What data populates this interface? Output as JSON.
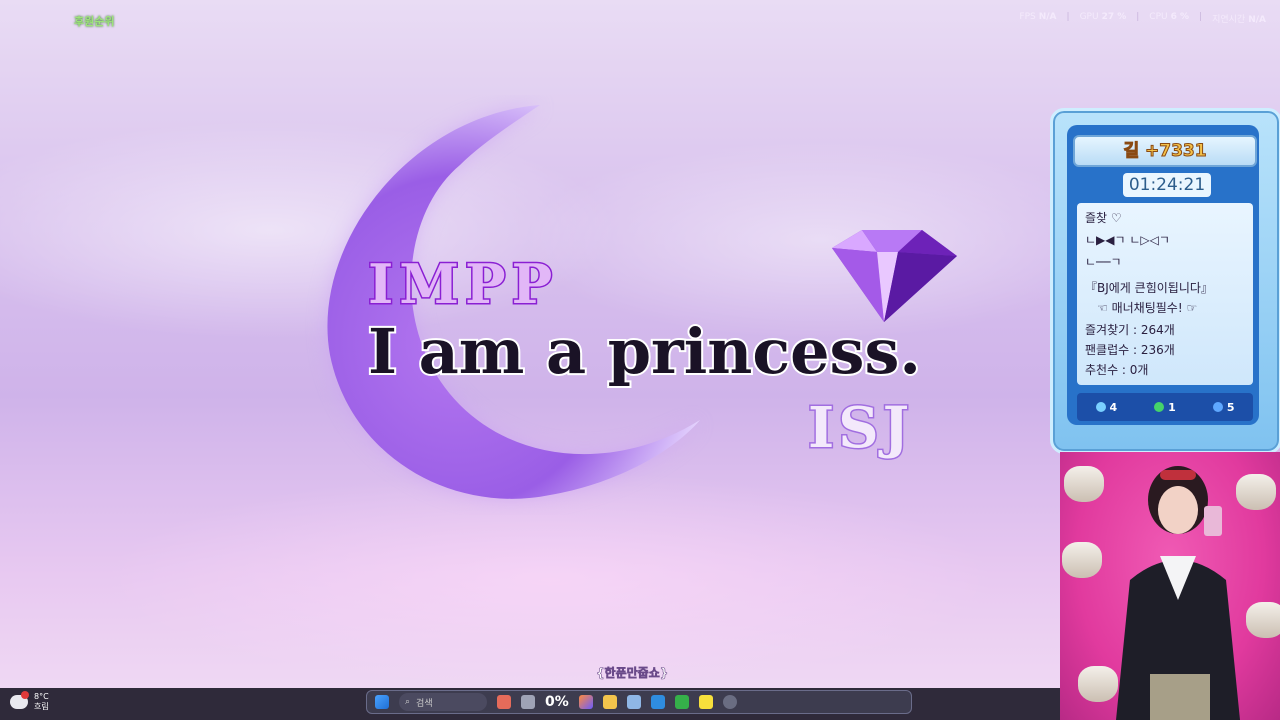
{
  "overlay": {
    "top_left_logo": "후원순위",
    "stats": [
      {
        "label": "FPS",
        "value": "N/A"
      },
      {
        "label": "GPU",
        "value": "27 %"
      },
      {
        "label": "CPU",
        "value": "6 %"
      },
      {
        "label": "지연시간",
        "value": "N/A"
      }
    ]
  },
  "title": {
    "line1": "IMPP",
    "line2": "I am a princess.",
    "line3": "ISJ"
  },
  "panel": {
    "header": "길 +7331",
    "timer": "01:24:21",
    "lines": [
      "즐찾 ♡",
      "ㄴ▶◀ㄱ   ㄴ▷◁ㄱ",
      "ㄴ──ㄱ",
      "『BJ에게 큰힘이됩니다』",
      "☜ 매너채팅필수! ☞",
      "즐겨찾기 : 264개",
      "팬클럽수 : 236개",
      "추천수 : 0개"
    ],
    "bar": [
      {
        "label": "4",
        "color": "#7ad0ff"
      },
      {
        "label": "1",
        "color": "#45d36a"
      },
      {
        "label": "5",
        "color": "#5fa8ff"
      }
    ]
  },
  "bottom": {
    "subtitle_tag": "{한푼만줍쇼}",
    "weather_temp": "8°C",
    "weather_text": "흐림",
    "search_placeholder": "검색",
    "cpu_percent": "0%"
  },
  "colors": {
    "accent_purple": "#8a1fd3",
    "panel_blue": "#2872c9",
    "cam_pink": "#e13a9e"
  }
}
